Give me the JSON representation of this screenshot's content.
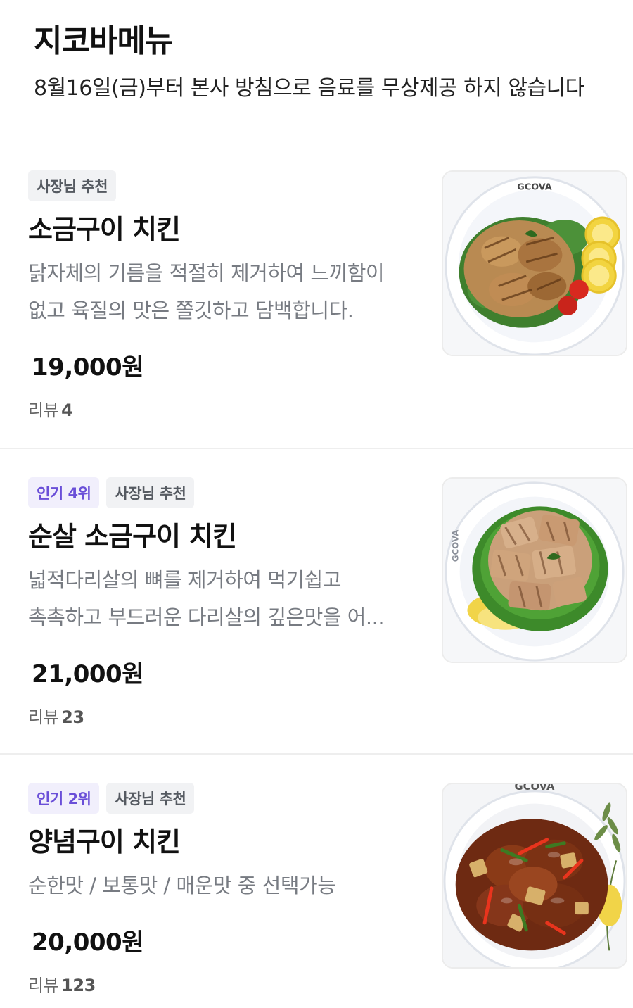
{
  "section": {
    "title": "지코바메뉴",
    "notice": "8월16일(금)부터 본사 방침으로 음료를 무상제공 하지 않습니다"
  },
  "items": [
    {
      "badges": {
        "owner": "사장님 추천"
      },
      "name": "소금구이 치킨",
      "desc_line1": "닭자체의 기름을 적절히 제거하여 느끼함이",
      "desc_line2": "없고 육질의 맛은 쫄깃하고 담백합니다.",
      "price": "19,000원",
      "review_label": "리뷰",
      "review_count": "4",
      "image_brand": "GCOVA"
    },
    {
      "badges": {
        "rank": "인기 4위",
        "owner": "사장님 추천"
      },
      "name": "순살 소금구이 치킨",
      "desc_line1": "넓적다리살의 뼈를 제거하여 먹기쉽고",
      "desc_line2": "촉촉하고 부드러운 다리살의 깊은맛을 어...",
      "price": "21,000원",
      "review_label": "리뷰",
      "review_count": "23",
      "image_brand": "GCOVA"
    },
    {
      "badges": {
        "rank": "인기 2위",
        "owner": "사장님 추천"
      },
      "name": "양념구이 치킨",
      "desc_line1": "순한맛 / 보통맛 / 매운맛 중 선택가능",
      "price": "20,000원",
      "review_label": "리뷰",
      "review_count": "123",
      "image_brand": "GCOVA"
    }
  ],
  "colors": {
    "rank_badge_text": "#6a4fd8",
    "rank_badge_bg": "#f1effc",
    "owner_badge_bg": "#f1f2f4",
    "desc_text": "#777b82"
  }
}
